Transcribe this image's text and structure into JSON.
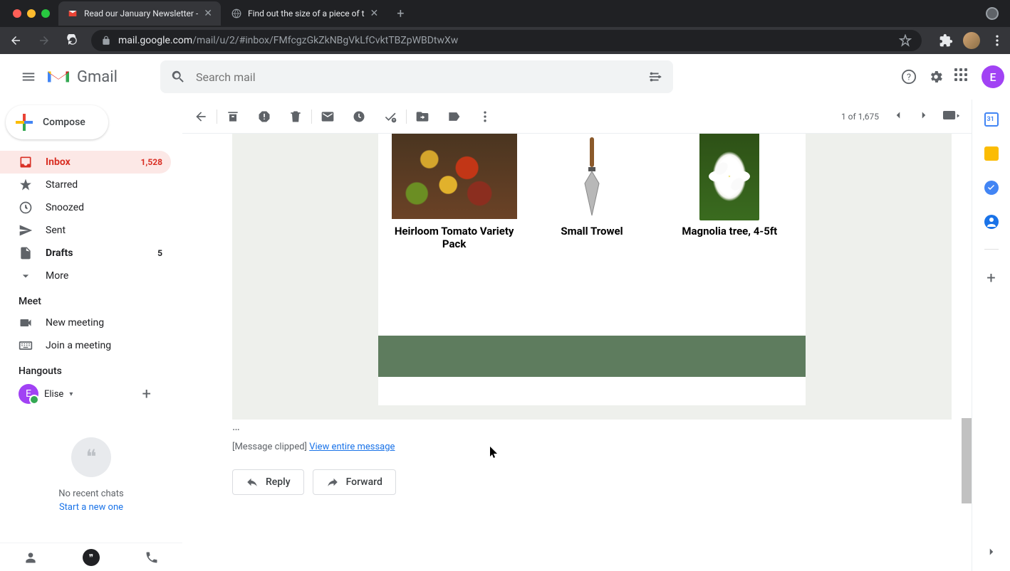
{
  "browser": {
    "tabs": [
      {
        "title": "Read our January Newsletter -",
        "favicon": "gmail"
      },
      {
        "title": "Find out the size of a piece of t",
        "favicon": "globe"
      }
    ],
    "url_host": "mail.google.com",
    "url_path": "/mail/u/2/#inbox/FMfcgzGkZkNBgVkLfCvktTBZpWBDtwXw"
  },
  "header": {
    "logo_text": "Gmail",
    "search_placeholder": "Search mail",
    "user_initial": "E"
  },
  "compose": {
    "label": "Compose"
  },
  "nav": {
    "inbox": {
      "label": "Inbox",
      "count": "1,528"
    },
    "starred": {
      "label": "Starred"
    },
    "snoozed": {
      "label": "Snoozed"
    },
    "sent": {
      "label": "Sent"
    },
    "drafts": {
      "label": "Drafts",
      "count": "5"
    },
    "more": {
      "label": "More"
    }
  },
  "meet": {
    "title": "Meet",
    "new_meeting": "New meeting",
    "join_meeting": "Join a meeting"
  },
  "hangouts": {
    "title": "Hangouts",
    "user_name": "Elise",
    "user_initial": "E",
    "empty_line1": "No recent chats",
    "empty_line2": "Start a new one"
  },
  "toolbar": {
    "position": "1 of 1,675"
  },
  "email": {
    "products": [
      {
        "name": "Heirloom Tomato Variety Pack"
      },
      {
        "name": "Small Trowel"
      },
      {
        "name": "Magnolia tree, 4-5ft"
      }
    ],
    "clipped_prefix": "[Message clipped]  ",
    "view_full": "View entire message",
    "reply": "Reply",
    "forward": "Forward"
  }
}
